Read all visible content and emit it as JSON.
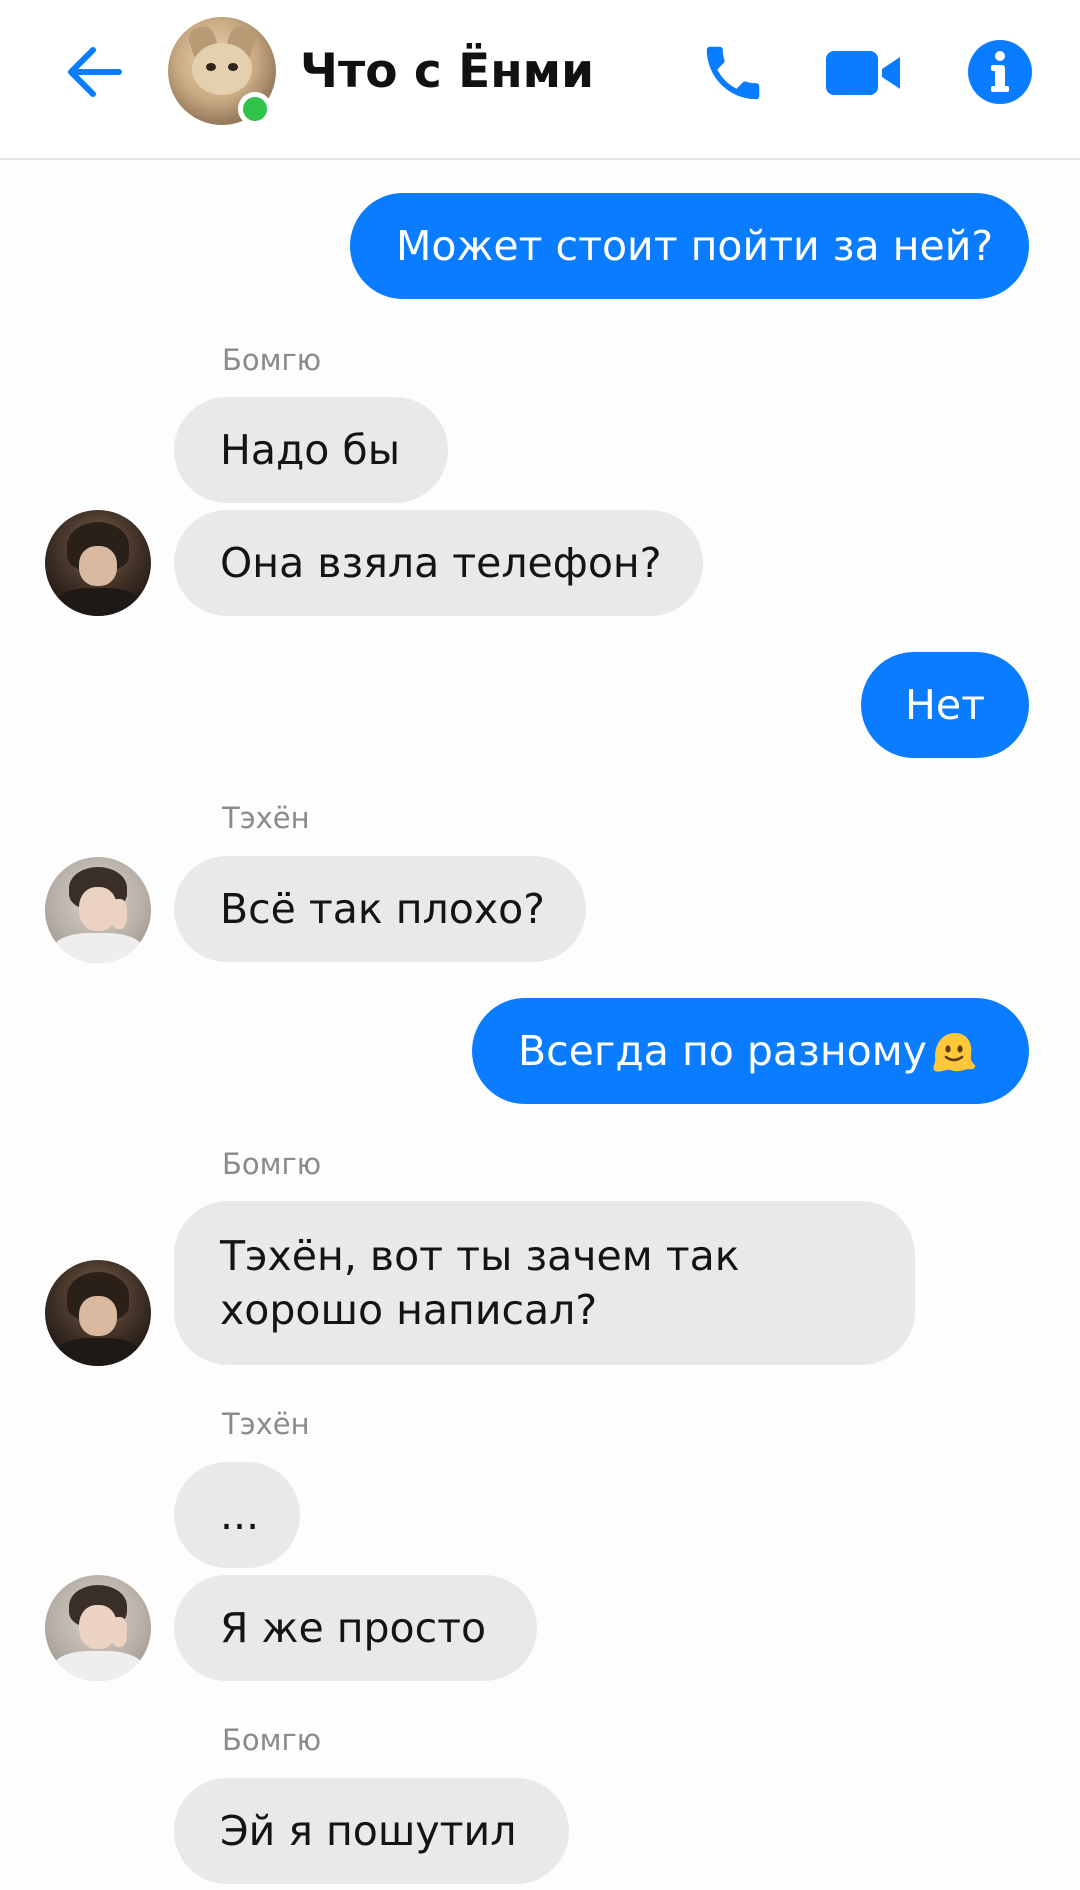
{
  "header": {
    "title": "Что с Ёнми",
    "online": true,
    "icons": {
      "back": "back-arrow-icon",
      "call": "phone-icon",
      "video": "video-camera-icon",
      "info": "info-icon"
    },
    "accent_color": "#0a7cff",
    "online_color": "#31c24a"
  },
  "messages": [
    {
      "direction": "out",
      "text": "Может стоит пойти за ней?"
    },
    {
      "direction": "in",
      "sender": "Бомгю",
      "text": "Надо бы"
    },
    {
      "direction": "in",
      "sender": "Бомгю",
      "text": "Она взяла телефон?"
    },
    {
      "direction": "out",
      "text": "Нет"
    },
    {
      "direction": "in",
      "sender": "Тэхён",
      "text": "Всё так плохо?"
    },
    {
      "direction": "out",
      "text": "Всегда по разному",
      "emoji": "melting-face-emoji"
    },
    {
      "direction": "in",
      "sender": "Бомгю",
      "text": "Тэхён, вот ты зачем так хорошо написал?"
    },
    {
      "direction": "in",
      "sender": "Тэхён",
      "text": "..."
    },
    {
      "direction": "in",
      "sender": "Тэхён",
      "text": "Я же просто"
    },
    {
      "direction": "in",
      "sender": "Бомгю",
      "text": "Эй я пошутил"
    }
  ],
  "colors": {
    "outgoing_bubble": "#0a7cff",
    "incoming_bubble": "#e9e9eb",
    "sender_label": "#8b8b8f"
  }
}
